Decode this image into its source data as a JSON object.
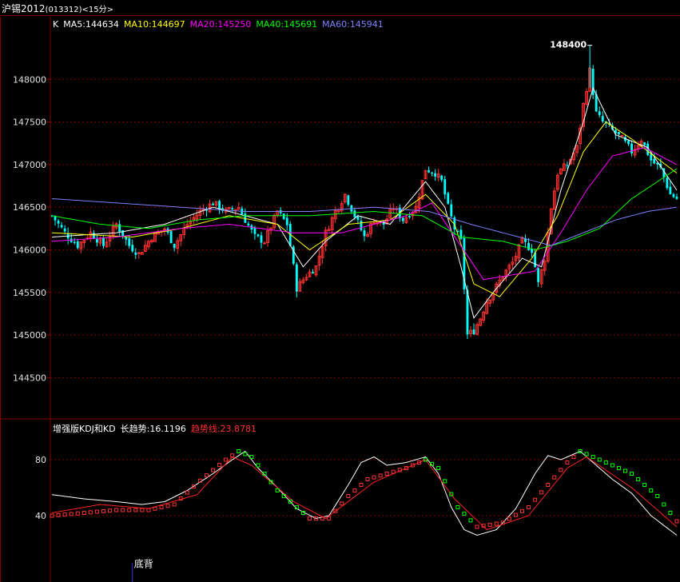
{
  "window": {
    "title": "沪锡2012",
    "code": "(013312)",
    "period": "<15分>"
  },
  "main_panel": {
    "indicator_line": [
      {
        "text": "K",
        "color": "#ffffff"
      },
      {
        "text": "MA5:144634",
        "color": "#ffffff"
      },
      {
        "text": "MA10:144697",
        "color": "#ffff00"
      },
      {
        "text": "MA20:145250",
        "color": "#ff00ff"
      },
      {
        "text": "MA40:145691",
        "color": "#00ff00"
      },
      {
        "text": "MA60:145941",
        "color": "#8080ff"
      }
    ],
    "high_marker": "148400"
  },
  "sub_panel": {
    "indicator_line": [
      {
        "text": "增强版KDJ和KD",
        "color": "#ffffff"
      },
      {
        "text": "长趋势:16.1196",
        "color": "#ffffff"
      },
      {
        "text": "趋势线:23.8781",
        "color": "#ff3030"
      }
    ],
    "annotation": "底背"
  },
  "colors": {
    "up": "#ff3232",
    "down": "#00ffff",
    "ma5": "#ffffff",
    "ma10": "#ffff00",
    "ma20": "#ff00ff",
    "ma40": "#00ff00",
    "ma60": "#8080ff",
    "grid": "#800000"
  },
  "chart_data": [
    {
      "type": "candlestick",
      "y_ticks": [
        "148000",
        "147500",
        "147000",
        "146500",
        "146000",
        "145500",
        "145000",
        "144500"
      ],
      "ylim": [
        144100,
        148650
      ],
      "high_value": 148400,
      "close_path": [
        [
          0,
          146400
        ],
        [
          4,
          146200
        ],
        [
          8,
          146050
        ],
        [
          12,
          146200
        ],
        [
          16,
          146050
        ],
        [
          20,
          146300
        ],
        [
          24,
          146050
        ],
        [
          27,
          145950
        ],
        [
          31,
          146150
        ],
        [
          35,
          146250
        ],
        [
          38,
          146050
        ],
        [
          42,
          146300
        ],
        [
          46,
          146450
        ],
        [
          50,
          146550
        ],
        [
          54,
          146450
        ],
        [
          58,
          146500
        ],
        [
          60,
          146350
        ],
        [
          63,
          146150
        ],
        [
          66,
          146100
        ],
        [
          70,
          146450
        ],
        [
          73,
          146300
        ],
        [
          76,
          145550
        ],
        [
          79,
          145700
        ],
        [
          82,
          145800
        ],
        [
          85,
          146200
        ],
        [
          88,
          146450
        ],
        [
          91,
          146650
        ],
        [
          94,
          146400
        ],
        [
          97,
          146150
        ],
        [
          100,
          146350
        ],
        [
          103,
          146300
        ],
        [
          106,
          146500
        ],
        [
          109,
          146350
        ],
        [
          113,
          146500
        ],
        [
          116,
          146950
        ],
        [
          119,
          146900
        ],
        [
          121,
          146800
        ],
        [
          123,
          146500
        ],
        [
          125,
          146250
        ],
        [
          127,
          146100
        ],
        [
          129,
          145000
        ],
        [
          131,
          145050
        ],
        [
          133,
          145200
        ],
        [
          135,
          145400
        ],
        [
          137,
          145500
        ],
        [
          140,
          145700
        ],
        [
          143,
          145850
        ],
        [
          146,
          146100
        ],
        [
          149,
          146000
        ],
        [
          151,
          145600
        ],
        [
          153,
          145900
        ],
        [
          155,
          146500
        ],
        [
          157,
          146900
        ],
        [
          160,
          147000
        ],
        [
          163,
          147200
        ],
        [
          165,
          147700
        ],
        [
          167,
          148100
        ],
        [
          169,
          147600
        ],
        [
          171,
          147500
        ],
        [
          174,
          147400
        ],
        [
          177,
          147300
        ],
        [
          180,
          147150
        ],
        [
          183,
          147300
        ],
        [
          186,
          147050
        ],
        [
          189,
          146950
        ],
        [
          192,
          146650
        ],
        [
          194,
          146600
        ]
      ],
      "ma_paths": {
        "MA5": [
          [
            0,
            146150
          ],
          [
            20,
            146200
          ],
          [
            35,
            146300
          ],
          [
            50,
            146500
          ],
          [
            60,
            146400
          ],
          [
            70,
            146300
          ],
          [
            78,
            145800
          ],
          [
            85,
            146100
          ],
          [
            95,
            146400
          ],
          [
            105,
            146300
          ],
          [
            116,
            146800
          ],
          [
            122,
            146500
          ],
          [
            127,
            145800
          ],
          [
            131,
            145200
          ],
          [
            137,
            145500
          ],
          [
            146,
            145900
          ],
          [
            152,
            145800
          ],
          [
            158,
            146700
          ],
          [
            165,
            147500
          ],
          [
            168,
            147900
          ],
          [
            175,
            147350
          ],
          [
            185,
            147200
          ],
          [
            194,
            146700
          ]
        ],
        "MA10": [
          [
            0,
            146200
          ],
          [
            25,
            146150
          ],
          [
            40,
            146250
          ],
          [
            55,
            146400
          ],
          [
            70,
            146300
          ],
          [
            80,
            146000
          ],
          [
            92,
            146300
          ],
          [
            105,
            146350
          ],
          [
            116,
            146650
          ],
          [
            125,
            146300
          ],
          [
            131,
            145600
          ],
          [
            139,
            145450
          ],
          [
            149,
            145900
          ],
          [
            157,
            146400
          ],
          [
            165,
            147150
          ],
          [
            172,
            147500
          ],
          [
            180,
            147300
          ],
          [
            194,
            146900
          ]
        ],
        "MA20": [
          [
            0,
            146100
          ],
          [
            20,
            146150
          ],
          [
            40,
            146250
          ],
          [
            55,
            146300
          ],
          [
            75,
            146200
          ],
          [
            90,
            146200
          ],
          [
            110,
            146400
          ],
          [
            118,
            146550
          ],
          [
            126,
            146100
          ],
          [
            134,
            145650
          ],
          [
            142,
            145700
          ],
          [
            150,
            145750
          ],
          [
            158,
            146200
          ],
          [
            166,
            146700
          ],
          [
            174,
            147100
          ],
          [
            184,
            147200
          ],
          [
            194,
            147000
          ]
        ],
        "MA40": [
          [
            0,
            146400
          ],
          [
            15,
            146300
          ],
          [
            30,
            146250
          ],
          [
            45,
            146350
          ],
          [
            60,
            146400
          ],
          [
            80,
            146400
          ],
          [
            100,
            146450
          ],
          [
            115,
            146400
          ],
          [
            127,
            146150
          ],
          [
            140,
            146100
          ],
          [
            150,
            146000
          ],
          [
            160,
            146100
          ],
          [
            170,
            146250
          ],
          [
            180,
            146600
          ],
          [
            194,
            146950
          ]
        ],
        "MA60": [
          [
            0,
            146600
          ],
          [
            20,
            146550
          ],
          [
            40,
            146500
          ],
          [
            60,
            146450
          ],
          [
            80,
            146450
          ],
          [
            100,
            146500
          ],
          [
            117,
            146450
          ],
          [
            130,
            146300
          ],
          [
            145,
            146150
          ],
          [
            155,
            146050
          ],
          [
            165,
            146200
          ],
          [
            175,
            146350
          ],
          [
            185,
            146450
          ],
          [
            194,
            146500
          ]
        ]
      }
    },
    {
      "type": "line",
      "y_ticks": [
        "80",
        "40"
      ],
      "ylim": [
        0,
        100
      ],
      "series": [
        {
          "name": "K",
          "color": "#ffffff",
          "points": [
            [
              0,
              55
            ],
            [
              10,
              52
            ],
            [
              20,
              50
            ],
            [
              28,
              48
            ],
            [
              35,
              50
            ],
            [
              42,
              58
            ],
            [
              50,
              70
            ],
            [
              56,
              80
            ],
            [
              60,
              86
            ],
            [
              64,
              74
            ],
            [
              70,
              60
            ],
            [
              76,
              45
            ],
            [
              82,
              38
            ],
            [
              86,
              40
            ],
            [
              92,
              62
            ],
            [
              96,
              78
            ],
            [
              100,
              82
            ],
            [
              104,
              76
            ],
            [
              110,
              78
            ],
            [
              116,
              82
            ],
            [
              120,
              70
            ],
            [
              124,
              46
            ],
            [
              128,
              30
            ],
            [
              132,
              26
            ],
            [
              138,
              30
            ],
            [
              144,
              45
            ],
            [
              150,
              70
            ],
            [
              154,
              83
            ],
            [
              158,
              80
            ],
            [
              164,
              86
            ],
            [
              168,
              78
            ],
            [
              174,
              66
            ],
            [
              180,
              56
            ],
            [
              186,
              40
            ],
            [
              194,
              26
            ]
          ]
        },
        {
          "name": "D",
          "color": "#ff2020",
          "points": [
            [
              0,
              42
            ],
            [
              15,
              48
            ],
            [
              30,
              45
            ],
            [
              45,
              55
            ],
            [
              56,
              82
            ],
            [
              62,
              76
            ],
            [
              75,
              50
            ],
            [
              85,
              38
            ],
            [
              100,
              64
            ],
            [
              116,
              80
            ],
            [
              125,
              52
            ],
            [
              135,
              30
            ],
            [
              148,
              40
            ],
            [
              160,
              74
            ],
            [
              166,
              82
            ],
            [
              180,
              60
            ],
            [
              194,
              32
            ]
          ]
        },
        {
          "name": "J",
          "color": "#00ff00",
          "points": [
            [
              0,
              40
            ],
            [
              10,
              42
            ],
            [
              20,
              44
            ],
            [
              30,
              44
            ],
            [
              38,
              48
            ],
            [
              46,
              65
            ],
            [
              54,
              80
            ],
            [
              58,
              86
            ],
            [
              62,
              82
            ],
            [
              70,
              58
            ],
            [
              80,
              38
            ],
            [
              86,
              38
            ],
            [
              92,
              54
            ],
            [
              98,
              66
            ],
            [
              104,
              70
            ],
            [
              110,
              74
            ],
            [
              116,
              80
            ],
            [
              120,
              74
            ],
            [
              126,
              46
            ],
            [
              132,
              32
            ],
            [
              140,
              35
            ],
            [
              148,
              46
            ],
            [
              154,
              62
            ],
            [
              160,
              78
            ],
            [
              164,
              86
            ],
            [
              170,
              80
            ],
            [
              180,
              70
            ],
            [
              188,
              54
            ],
            [
              194,
              36
            ]
          ]
        }
      ]
    }
  ]
}
